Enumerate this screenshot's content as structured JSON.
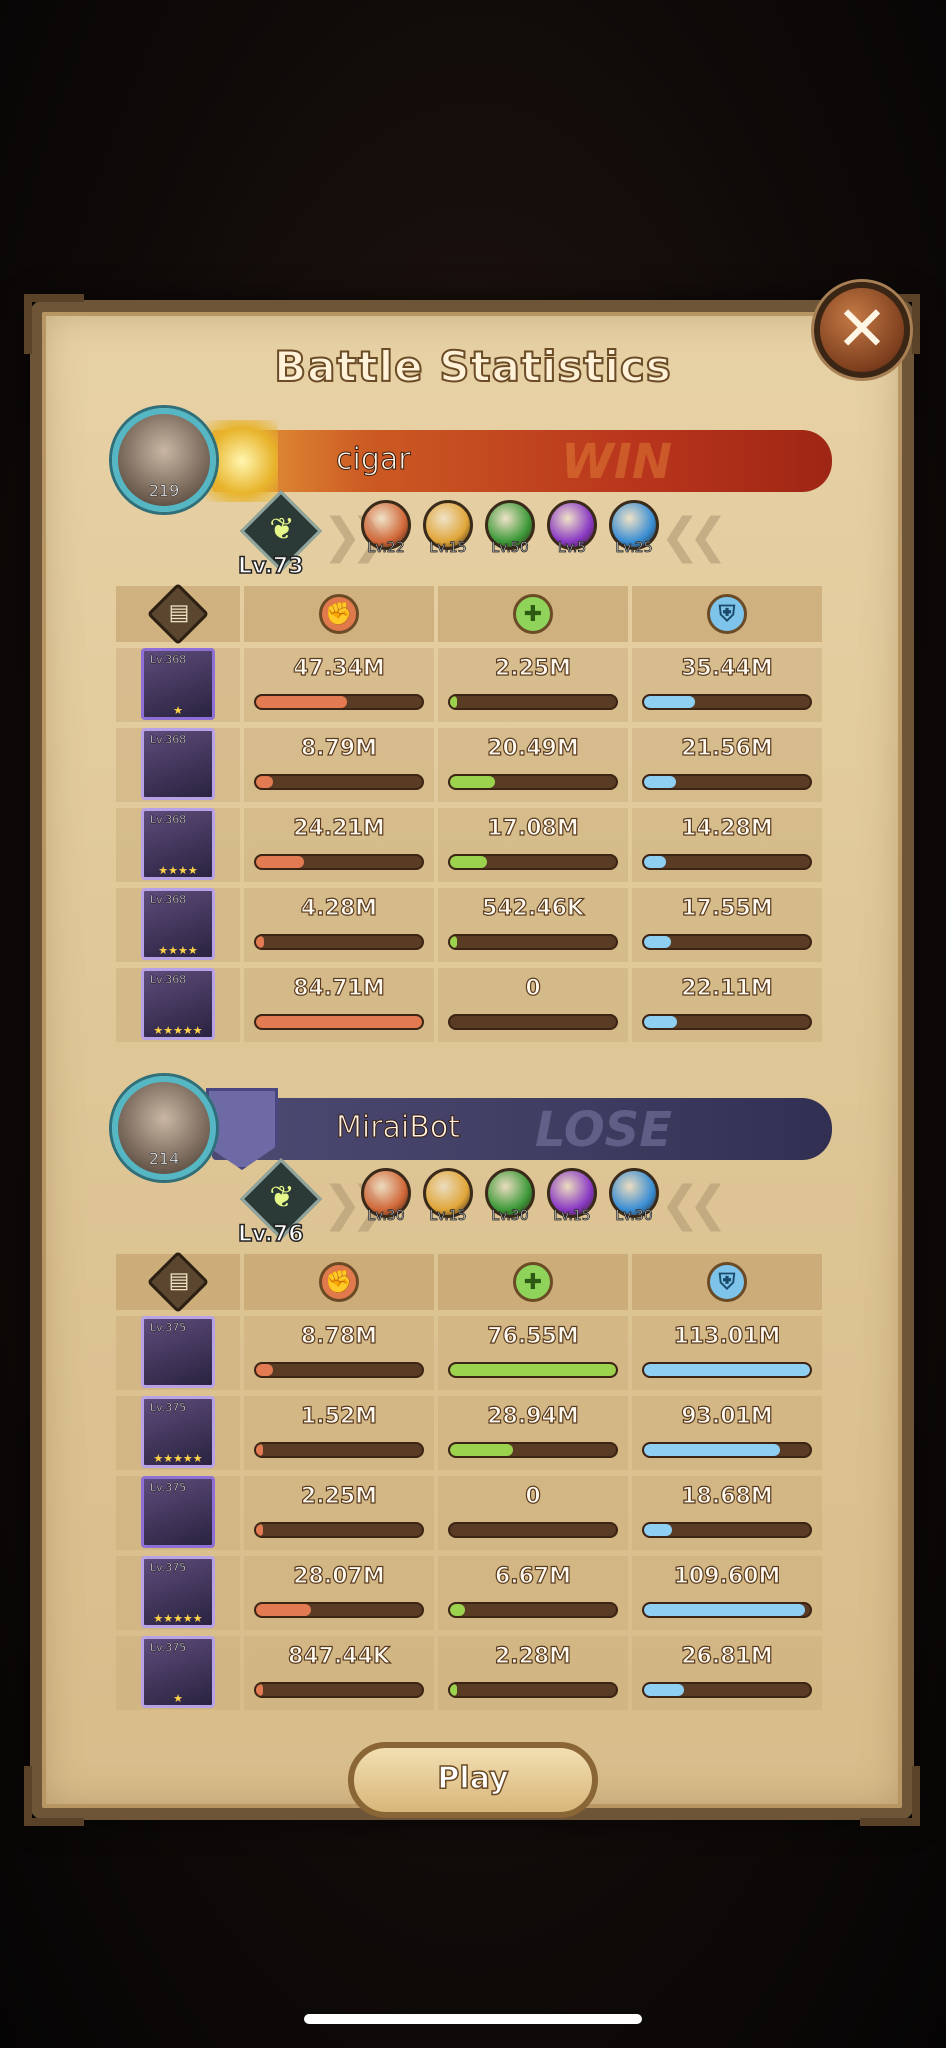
{
  "title": "Battle Statistics",
  "play_label": "Play",
  "teams": [
    {
      "player_name": "cigar",
      "avatar_level": "219",
      "result": "WIN",
      "formation_level": "Lv.73",
      "factions": [
        {
          "label": "Lv.22",
          "color": "#d1683a",
          "icon": "lightbearer-icon"
        },
        {
          "label": "Lv.15",
          "color": "#e0a63a",
          "icon": "mauler-icon"
        },
        {
          "label": "Lv.50",
          "color": "#3e9a3a",
          "icon": "wilder-icon"
        },
        {
          "label": "Lv.5",
          "color": "#8a3ac4",
          "icon": "graveborn-icon"
        },
        {
          "label": "Lv.25",
          "color": "#3a8ed4",
          "icon": "celestial-icon"
        }
      ],
      "heroes": [
        {
          "level": "Lv.368",
          "stars": "★",
          "frame": "#8e6fd6",
          "damage": "47.34M",
          "damage_pct": 0.55,
          "healing": "2.25M",
          "healing_pct": 0.03,
          "taken": "35.44M",
          "taken_pct": 0.31
        },
        {
          "level": "Lv.368",
          "stars": "",
          "frame": "#b8a2e6",
          "damage": "8.79M",
          "damage_pct": 0.1,
          "healing": "20.49M",
          "healing_pct": 0.27,
          "taken": "21.56M",
          "taken_pct": 0.19
        },
        {
          "level": "Lv.368",
          "stars": "★★★★",
          "frame": "#b8a2e6",
          "damage": "24.21M",
          "damage_pct": 0.29,
          "healing": "17.08M",
          "healing_pct": 0.22,
          "taken": "14.28M",
          "taken_pct": 0.13
        },
        {
          "level": "Lv.368",
          "stars": "★★★★",
          "frame": "#b8a2e6",
          "damage": "4.28M",
          "damage_pct": 0.05,
          "healing": "542.46K",
          "healing_pct": 0.01,
          "taken": "17.55M",
          "taken_pct": 0.16
        },
        {
          "level": "Lv.368",
          "stars": "★★★★★",
          "frame": "#b8a2e6",
          "damage": "84.71M",
          "damage_pct": 1.0,
          "healing": "0",
          "healing_pct": 0.0,
          "taken": "22.11M",
          "taken_pct": 0.2
        }
      ]
    },
    {
      "player_name": "MiraiBot",
      "avatar_level": "214",
      "result": "LOSE",
      "formation_level": "Lv.76",
      "factions": [
        {
          "label": "Lv.30",
          "color": "#d1683a",
          "icon": "lightbearer-icon"
        },
        {
          "label": "Lv.15",
          "color": "#e0a63a",
          "icon": "mauler-icon"
        },
        {
          "label": "Lv.30",
          "color": "#3e9a3a",
          "icon": "wilder-icon"
        },
        {
          "label": "Lv.15",
          "color": "#8a3ac4",
          "icon": "graveborn-icon"
        },
        {
          "label": "Lv.30",
          "color": "#3a8ed4",
          "icon": "celestial-icon"
        }
      ],
      "heroes": [
        {
          "level": "Lv.375",
          "stars": "",
          "frame": "#b8a2e6",
          "damage": "8.78M",
          "damage_pct": 0.1,
          "healing": "76.55M",
          "healing_pct": 1.0,
          "taken": "113.01M",
          "taken_pct": 1.0
        },
        {
          "level": "Lv.375",
          "stars": "★★★★★",
          "frame": "#b8a2e6",
          "damage": "1.52M",
          "damage_pct": 0.02,
          "healing": "28.94M",
          "healing_pct": 0.38,
          "taken": "93.01M",
          "taken_pct": 0.82
        },
        {
          "level": "Lv.375",
          "stars": "",
          "frame": "#8e6fd6",
          "damage": "2.25M",
          "damage_pct": 0.03,
          "healing": "0",
          "healing_pct": 0.0,
          "taken": "18.68M",
          "taken_pct": 0.17
        },
        {
          "level": "Lv.375",
          "stars": "★★★★★",
          "frame": "#b8a2e6",
          "damage": "28.07M",
          "damage_pct": 0.33,
          "healing": "6.67M",
          "healing_pct": 0.09,
          "taken": "109.60M",
          "taken_pct": 0.97
        },
        {
          "level": "Lv.375",
          "stars": "★",
          "frame": "#b8a2e6",
          "damage": "847.44K",
          "damage_pct": 0.01,
          "healing": "2.28M",
          "healing_pct": 0.03,
          "taken": "26.81M",
          "taken_pct": 0.24
        }
      ]
    }
  ],
  "column_icons": [
    "hero-list-icon",
    "damage-dealt-icon",
    "healing-icon",
    "damage-taken-icon"
  ]
}
